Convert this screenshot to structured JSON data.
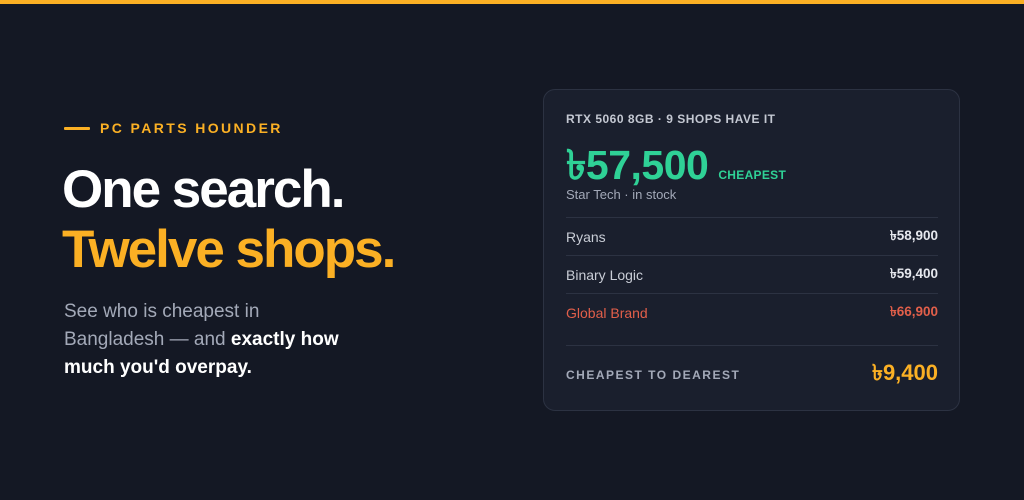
{
  "brand": {
    "eyebrow": "PC PARTS HOUNDER",
    "accent_color": "#fbb024"
  },
  "hero": {
    "line1": "One search.",
    "line2": "Twelve shops.",
    "sub_plain": "See who is cheapest in Bangladesh — and ",
    "sub_emphasis": "exactly how much you'd overpay."
  },
  "card": {
    "heading": "RTX 5060 8GB · 9 SHOPS HAVE IT",
    "best_price": "৳57,500",
    "best_badge": "CHEAPEST",
    "best_shop": "Star Tech · in stock",
    "best_color": "#2fd196",
    "rows": [
      {
        "name": "Ryans",
        "price": "৳58,900"
      },
      {
        "name": "Binary Logic",
        "price": "৳59,400"
      },
      {
        "name": "Global Brand",
        "price": "৳66,900"
      }
    ],
    "warn_color": "#e25f4a",
    "footer_label": "CHEAPEST TO DEAREST",
    "footer_value": "৳9,400"
  }
}
